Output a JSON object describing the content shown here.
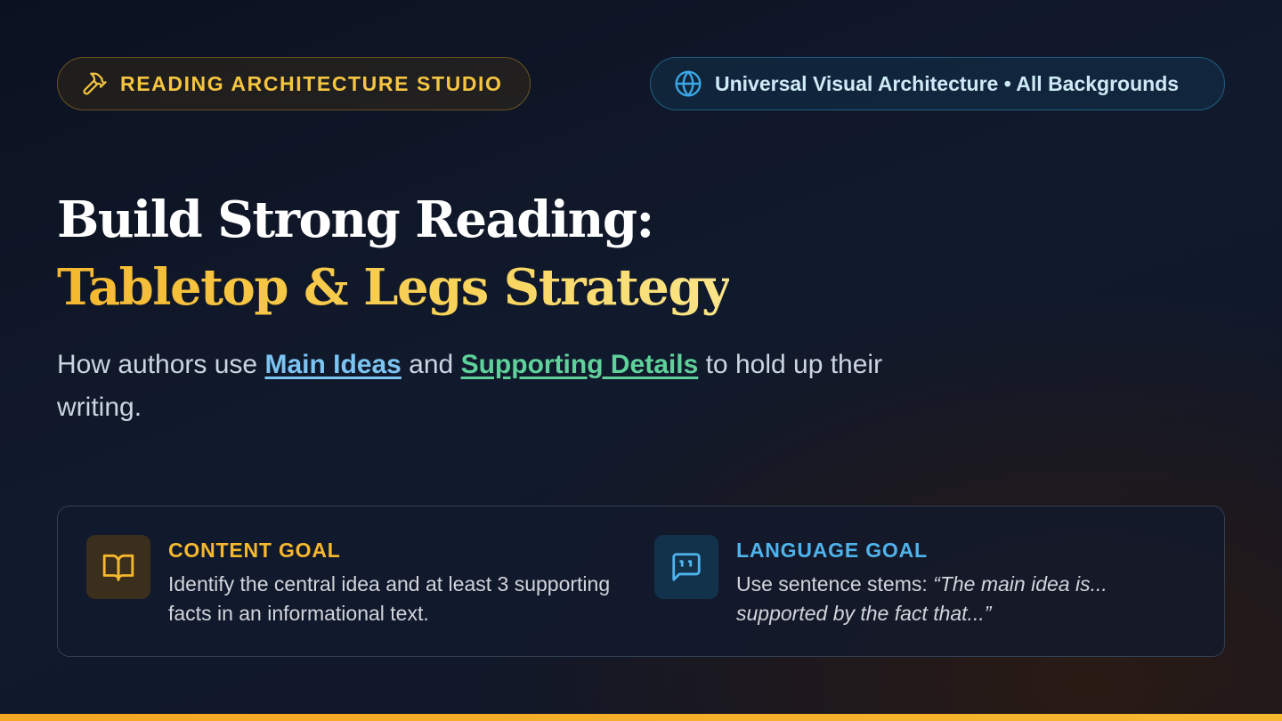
{
  "header": {
    "studio_label": "READING ARCHITECTURE STUDIO",
    "universal_label": "Universal Visual Architecture • All Backgrounds",
    "studio_icon": "hammer-icon",
    "universal_icon": "globe-icon"
  },
  "title": {
    "line1": "Build Strong Reading:",
    "line2": "Tableтop & Legs Strategy"
  },
  "subtitle": {
    "prefix": "How authors use ",
    "main_ideas": "Main Ideas",
    "and": " and ",
    "supporting_details": "Supporting Details",
    "suffix": " to hold up their writing."
  },
  "goals": {
    "content": {
      "icon": "book-icon",
      "heading": "CONTENT GOAL",
      "text": "Identify the central idea and at least 3 supporting facts in an informational text."
    },
    "language": {
      "icon": "speech-quote-icon",
      "heading": "LANGUAGE GOAL",
      "text_prefix": "Use sentence stems: ",
      "text_quote": "“The main idea is... supported by the fact that...”"
    }
  },
  "colors": {
    "accent_gold": "#f5b82e",
    "accent_blue": "#4fb3ec",
    "accent_green": "#5fd19a",
    "bottom_bar": "#f5a623"
  }
}
